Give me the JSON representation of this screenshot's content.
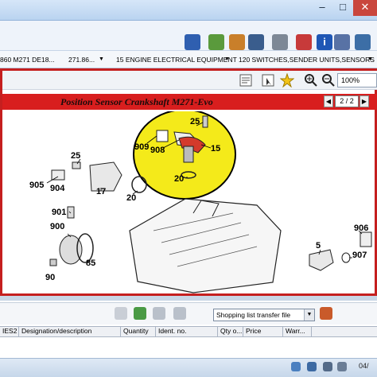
{
  "toolbar": {
    "icons": [
      "cart-icon",
      "scan-icon",
      "basket-icon",
      "vehicle-icon",
      "print-icon",
      "eraser-icon",
      "info-icon",
      "book-icon",
      "email-icon"
    ]
  },
  "breadcrumb": {
    "items": [
      "860 M271 DE18...",
      "271.86...",
      "15 ENGINE ELECTRICAL EQUIPMENT",
      "120 SWITCHES,SENDER UNITS,SENSORS"
    ]
  },
  "viewer": {
    "zoom": "100%",
    "title": "Position Sensor Crankshaft M271-Evo",
    "page": "2 / 2"
  },
  "diagram": {
    "callouts": [
      "25",
      "909",
      "908",
      "15",
      "20",
      "25",
      "905",
      "904",
      "17",
      "20",
      "901",
      "900",
      "85",
      "90",
      "5",
      "906",
      "907"
    ]
  },
  "shopping": {
    "select_value": "Shopping list transfer file"
  },
  "table": {
    "headers": [
      "IES2",
      "Designation/description",
      "Quantity",
      "Ident. no.",
      "Qty o...",
      "Price",
      "Warr..."
    ]
  },
  "taskbar": {
    "clock": "04/"
  },
  "colors": {
    "frame_red": "#c51f1f",
    "title_band": "#d81e1e",
    "highlight": "#f4ea1a"
  }
}
